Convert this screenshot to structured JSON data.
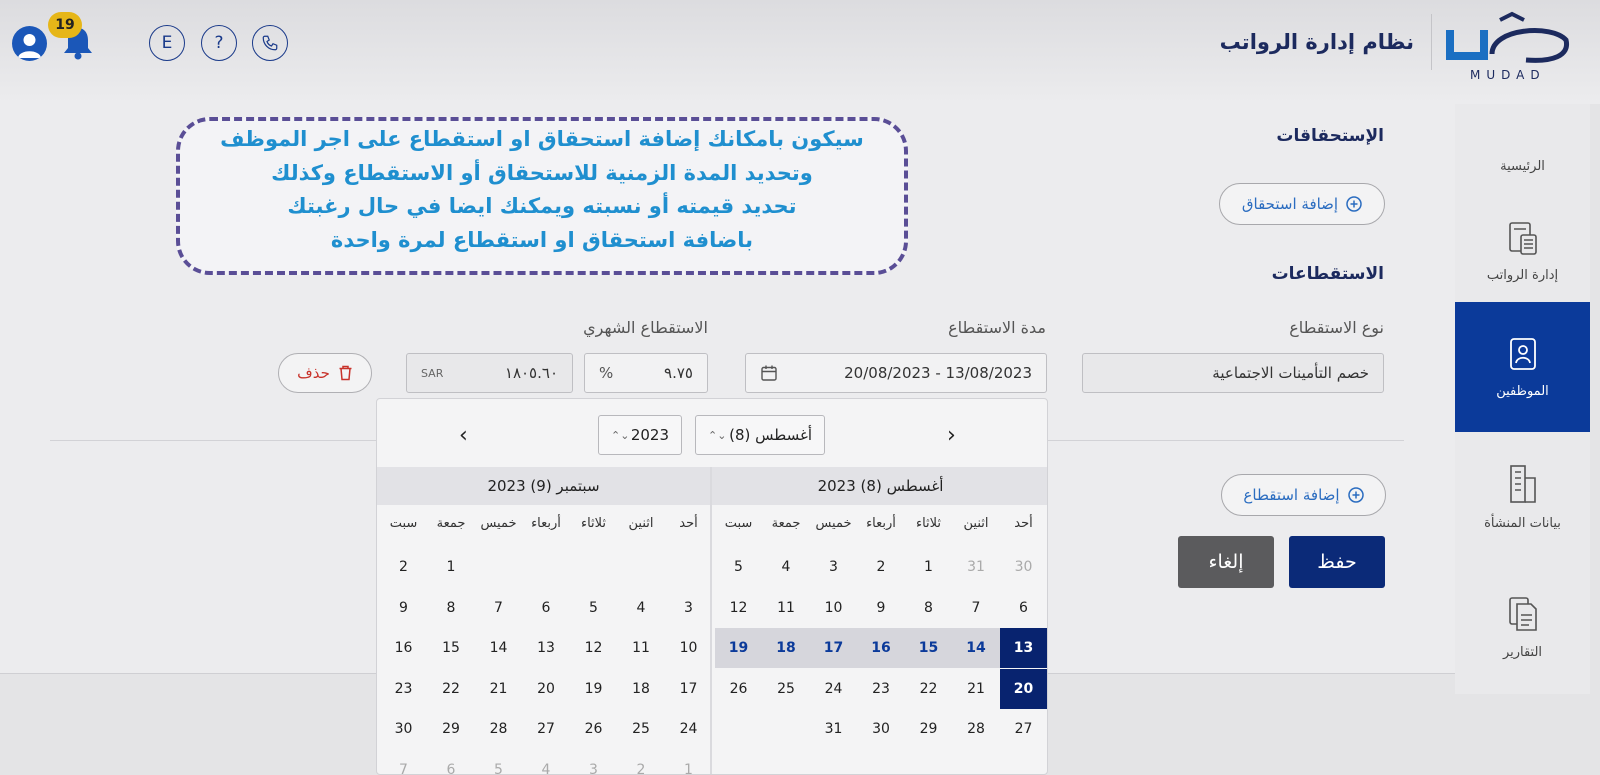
{
  "header": {
    "app_title": "نظام إدارة الرواتب",
    "logo_text": "MUDAD",
    "notification_count": "19",
    "language_label": "E",
    "help_label": "?"
  },
  "sidebar": {
    "items": [
      {
        "label": "الرئيسية",
        "icon": "home-icon"
      },
      {
        "label": "إدارة الرواتب",
        "icon": "payroll-icon"
      },
      {
        "label": "الموظفين",
        "icon": "employees-icon",
        "active": true
      },
      {
        "label": "بيانات المنشأة",
        "icon": "building-icon"
      },
      {
        "label": "التقارير",
        "icon": "reports-icon"
      }
    ]
  },
  "entitlements": {
    "title": "الإستحقاقات",
    "add_button": "إضافة استحقاق"
  },
  "deductions": {
    "title": "الاستقطاعات",
    "type_label": "نوع الاستقطاع",
    "type_value": "خصم التأمينات الاجتماعية",
    "period_label": "مدة الاستقطاع",
    "period_value": "20/08/2023 - 13/08/2023",
    "monthly_label": "الاستقطاع الشهري",
    "percent_value": "٩.٧٥",
    "percent_symbol": "%",
    "amount_value": "١٨٠٥.٦٠",
    "currency": "SAR",
    "delete_button": "حذف",
    "add_button": "إضافة استقطاع"
  },
  "actions": {
    "save": "حفظ",
    "cancel": "إلغاء"
  },
  "callout": {
    "lines": [
      "سيكون بامكانك إضافة استحقاق او استقطاع على اجر الموظف",
      "وتحديد المدة الزمنية للاستحقاق أو الاستقطاع وكذلك",
      "تحديد قيمته أو نسبته ويمكنك ايضا في حال رغبتك",
      "باضافة استحقاق او استقطاع لمرة واحدة"
    ]
  },
  "calendar": {
    "month_select": "أغسطس (8)",
    "year_select": "2023",
    "weekdays": [
      "أحد",
      "اثنين",
      "ثلاثاء",
      "أربعاء",
      "خميس",
      "جمعة",
      "سبت"
    ],
    "months": [
      {
        "title": "أغسطس (8) 2023",
        "weeks": [
          [
            {
              "d": "30",
              "m": true
            },
            {
              "d": "31",
              "m": true
            },
            {
              "d": "1"
            },
            {
              "d": "2"
            },
            {
              "d": "3"
            },
            {
              "d": "4"
            },
            {
              "d": "5"
            }
          ],
          [
            {
              "d": "6"
            },
            {
              "d": "7"
            },
            {
              "d": "8"
            },
            {
              "d": "9"
            },
            {
              "d": "10"
            },
            {
              "d": "11"
            },
            {
              "d": "12"
            }
          ],
          [
            {
              "d": "13",
              "s": "sel"
            },
            {
              "d": "14",
              "s": "inrange"
            },
            {
              "d": "15",
              "s": "inrange"
            },
            {
              "d": "16",
              "s": "inrange"
            },
            {
              "d": "17",
              "s": "inrange"
            },
            {
              "d": "18",
              "s": "inrange"
            },
            {
              "d": "19",
              "s": "inrange"
            }
          ],
          [
            {
              "d": "20",
              "s": "sel"
            },
            {
              "d": "21"
            },
            {
              "d": "22"
            },
            {
              "d": "23"
            },
            {
              "d": "24"
            },
            {
              "d": "25"
            },
            {
              "d": "26"
            }
          ],
          [
            {
              "d": "27"
            },
            {
              "d": "28"
            },
            {
              "d": "29"
            },
            {
              "d": "30"
            },
            {
              "d": "31"
            },
            {
              "d": ""
            },
            {
              "d": ""
            }
          ]
        ]
      },
      {
        "title": "سبتمبر (9) 2023",
        "weeks": [
          [
            {
              "d": ""
            },
            {
              "d": ""
            },
            {
              "d": ""
            },
            {
              "d": ""
            },
            {
              "d": ""
            },
            {
              "d": "1"
            },
            {
              "d": "2"
            }
          ],
          [
            {
              "d": "3"
            },
            {
              "d": "4"
            },
            {
              "d": "5"
            },
            {
              "d": "6"
            },
            {
              "d": "7"
            },
            {
              "d": "8"
            },
            {
              "d": "9"
            }
          ],
          [
            {
              "d": "10"
            },
            {
              "d": "11"
            },
            {
              "d": "12"
            },
            {
              "d": "13"
            },
            {
              "d": "14"
            },
            {
              "d": "15"
            },
            {
              "d": "16"
            }
          ],
          [
            {
              "d": "17"
            },
            {
              "d": "18"
            },
            {
              "d": "19"
            },
            {
              "d": "20"
            },
            {
              "d": "21"
            },
            {
              "d": "22"
            },
            {
              "d": "23"
            }
          ],
          [
            {
              "d": "24"
            },
            {
              "d": "25"
            },
            {
              "d": "26"
            },
            {
              "d": "27"
            },
            {
              "d": "28"
            },
            {
              "d": "29"
            },
            {
              "d": "30"
            }
          ],
          [
            {
              "d": "1",
              "m": true
            },
            {
              "d": "2",
              "m": true
            },
            {
              "d": "3",
              "m": true
            },
            {
              "d": "4",
              "m": true
            },
            {
              "d": "5",
              "m": true
            },
            {
              "d": "6",
              "m": true
            },
            {
              "d": "7",
              "m": true
            }
          ]
        ]
      }
    ]
  },
  "colors": {
    "primary": "#0b3a9a",
    "selected_day": "#08236f",
    "accent_link": "#2a6cc0",
    "callout_text": "#1f8fcf",
    "badge": "#e6b618"
  }
}
